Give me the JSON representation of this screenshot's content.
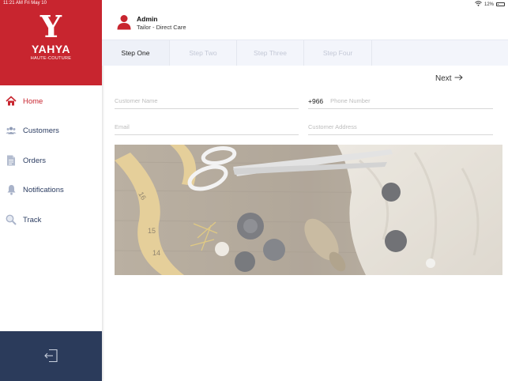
{
  "status_bar": {
    "time_date": "11:21 AM  Fri May 10",
    "battery": "12%"
  },
  "brand": {
    "monogram": "Y",
    "name": "YAHYA",
    "tagline": "HAUTE-COUTURE",
    "color": "#c8252f"
  },
  "sidebar": {
    "items": [
      {
        "label": "Home",
        "icon": "home-icon",
        "active": true
      },
      {
        "label": "Customers",
        "icon": "users-icon",
        "active": false
      },
      {
        "label": "Orders",
        "icon": "document-icon",
        "active": false
      },
      {
        "label": "Notifications",
        "icon": "bell-icon",
        "active": false
      },
      {
        "label": "Track",
        "icon": "search-icon",
        "active": false
      }
    ],
    "footer_color": "#2b3b5b"
  },
  "header": {
    "user_name": "Admin",
    "user_role": "Tailor - Direct Care"
  },
  "steps": [
    {
      "label": "Step One",
      "active": true
    },
    {
      "label": "Step Two",
      "active": false
    },
    {
      "label": "Step Three",
      "active": false
    },
    {
      "label": "Step Four",
      "active": false
    }
  ],
  "next_label": "Next",
  "form": {
    "customer_name_placeholder": "Customer Name",
    "phone_code": "+966",
    "phone_placeholder": "Phone Number",
    "email_placeholder": "Email",
    "address_placeholder": "Customer Address"
  }
}
